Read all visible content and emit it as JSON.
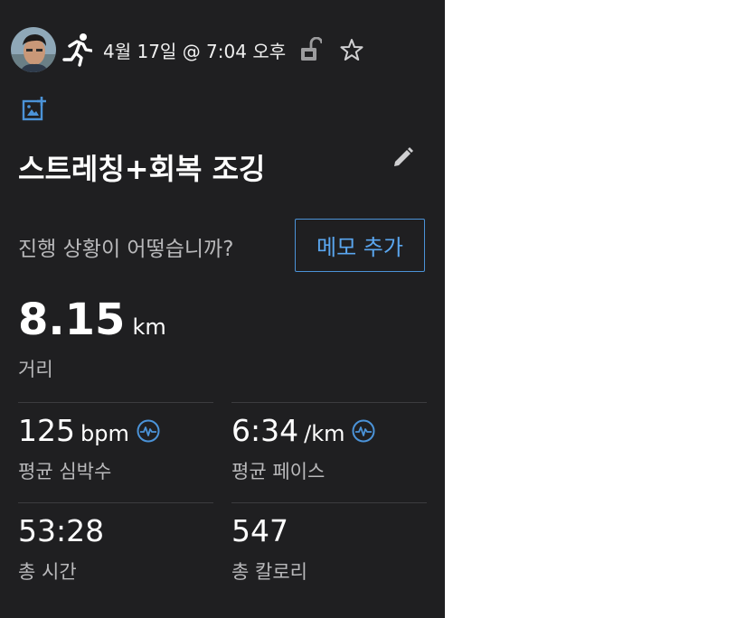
{
  "header": {
    "date": "4월 17일 @ 7:04 오후"
  },
  "activity": {
    "title": "스트레칭+회복 조깅",
    "prompt": "진행 상황이 어떻습니까?",
    "note_button": "메모 추가"
  },
  "distance": {
    "value": "8.15",
    "unit": "km",
    "label": "거리"
  },
  "stats": {
    "heart_rate": {
      "value": "125",
      "unit": "bpm",
      "label": "평균 심박수"
    },
    "pace": {
      "value": "6:34",
      "unit": "/km",
      "label": "평균 페이스"
    },
    "time": {
      "value": "53:28",
      "label": "총 시간"
    },
    "calories": {
      "value": "547",
      "label": "총 칼로리"
    }
  },
  "colors": {
    "background": "#1f1f21",
    "accent": "#4b93d8"
  },
  "icons": [
    "avatar",
    "running-icon",
    "unlock-icon",
    "star-icon",
    "add-photo-icon",
    "edit-pencil-icon",
    "heart-pulse-icon"
  ]
}
